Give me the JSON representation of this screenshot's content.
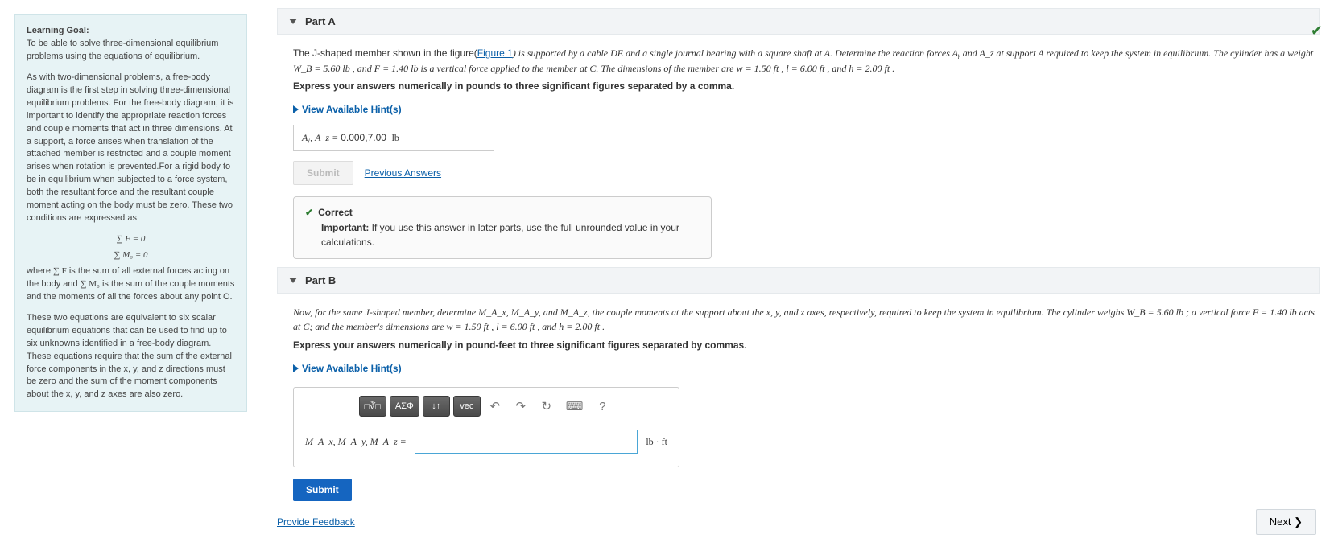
{
  "side": {
    "goal_label": "Learning Goal:",
    "goal_text": "To be able to solve three-dimensional equilibrium problems using the equations of equilibrium.",
    "para1": "As with two-dimensional problems, a free-body diagram is the first step in solving three-dimensional equilibrium problems.  For the free-body diagram, it is important to identify the appropriate reaction forces and couple moments that act in three dimensions.  At a support, a force arises when translation of the attached member is restricted and a couple moment arises when rotation is prevented.For a rigid body to be in equilibrium when subjected to a force system, both the resultant force and the resultant couple moment acting on the body must be zero.  These two conditions are expressed as",
    "eq1": "∑ F = 0",
    "eq2": "∑ M₀ = 0",
    "para2_pre": "where ",
    "para2_mid1": "∑ F",
    "para2_mid2": " is the sum of all external forces acting on the body and ",
    "para2_mid3": "∑ M₀",
    "para2_end": " is the sum of the couple moments and the moments of all the forces about any point O.",
    "para3": "These two equations are equivalent to six scalar equilibrium equations that can be used to find up to six unknowns identified in a free-body diagram.  These equations require that the sum of the external force components in the x, y, and z directions must be zero and the sum of the moment components about the x, y, and z axes are also zero."
  },
  "partA": {
    "title": "Part A",
    "prompt_pre": "The J-shaped member shown in the figure(",
    "figure_link": "Figure 1",
    "prompt_post": ") is supported by a cable DE and a single journal bearing with a square shaft at A. Determine the reaction forces Aᵧ and A_z at support A required to keep the system in equilibrium.  The cylinder has a weight W_B = 5.60 lb , and F = 1.40 lb is a vertical force applied to the member at C.  The dimensions of the member are w = 1.50 ft , l = 6.00 ft , and h = 2.00 ft .",
    "instr": "Express your answers numerically in pounds to three significant figures separated by a comma.",
    "hints": "View Available Hint(s)",
    "ans_label": "Aᵧ, A_z = ",
    "ans_value": "0.000,7.00",
    "ans_unit": "lb",
    "submit": "Submit",
    "prev": "Previous Answers",
    "correct_label": "Correct",
    "correct_note_label": "Important:",
    "correct_note": " If you use this answer in later parts, use the full unrounded value in your calculations."
  },
  "partB": {
    "title": "Part B",
    "prompt": "Now, for the same J-shaped member, determine M_A_x, M_A_y, and M_A_z, the couple moments at the support about the x, y, and z axes, respectively, required to keep the system in equilibrium.  The cylinder weighs W_B = 5.60 lb ; a vertical force F = 1.40 lb acts at C; and the member's dimensions are w = 1.50 ft , l = 6.00 ft , and h = 2.00 ft .",
    "instr": "Express your answers numerically in pound-feet to three significant figures separated by commas.",
    "hints": "View Available Hint(s)",
    "toolbar": {
      "templates": "□∛□",
      "greek": "ΑΣΦ",
      "scripts": "↓↑",
      "vec": "vec",
      "undo": "↶",
      "redo": "↷",
      "reset": "↻",
      "keyboard": "⌨",
      "help": "?"
    },
    "ans_label": "M_A_x, M_A_y, M_A_z = ",
    "ans_value": "",
    "ans_unit": "lb · ft",
    "submit": "Submit"
  },
  "footer": {
    "feedback": "Provide Feedback",
    "next": "Next ❯"
  }
}
